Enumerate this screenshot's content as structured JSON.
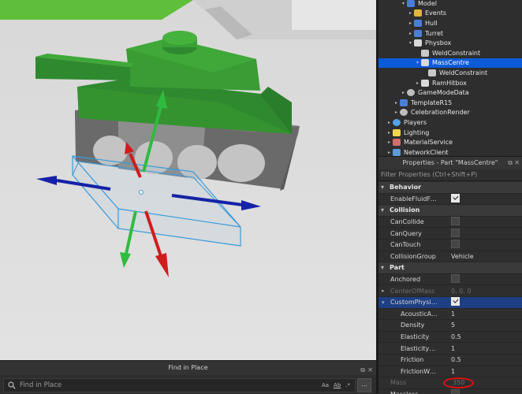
{
  "explorer": {
    "items": [
      {
        "label": "Model",
        "icon": "model-icon",
        "arrow": "▾",
        "indent": 0
      },
      {
        "label": "Events",
        "icon": "folder-icon",
        "arrow": "▸",
        "indent": 1
      },
      {
        "label": "Hull",
        "icon": "model-icon",
        "arrow": "▸",
        "indent": 1
      },
      {
        "label": "Turret",
        "icon": "model-icon",
        "arrow": "▸",
        "indent": 1
      },
      {
        "label": "Physbox",
        "icon": "part-icon",
        "arrow": "▾",
        "indent": 1
      },
      {
        "label": "WeldConstraint",
        "icon": "constraint-icon",
        "arrow": "",
        "indent": 2
      },
      {
        "label": "MassCentre",
        "icon": "part-icon",
        "arrow": "▾",
        "indent": 2,
        "selected": true
      },
      {
        "label": "WeldConstraint",
        "icon": "constraint-icon",
        "arrow": "",
        "indent": 3
      },
      {
        "label": "RamHitbox",
        "icon": "part-icon",
        "arrow": "▸",
        "indent": 2
      },
      {
        "label": "GameModeData",
        "icon": "gear-icon",
        "arrow": "▸",
        "indent": 0
      },
      {
        "label": "TemplateR15",
        "icon": "model-icon",
        "arrow": "▸",
        "indent": -1
      },
      {
        "label": "CelebrationRender",
        "icon": "gear-icon",
        "arrow": "▸",
        "indent": -1
      },
      {
        "label": "Players",
        "icon": "players-icon",
        "arrow": "▸",
        "indent": -2
      },
      {
        "label": "Lighting",
        "icon": "lighting-icon",
        "arrow": "▸",
        "indent": -2
      },
      {
        "label": "MaterialService",
        "icon": "material-icon",
        "arrow": "▸",
        "indent": -2
      },
      {
        "label": "NetworkClient",
        "icon": "network-icon",
        "arrow": "▸",
        "indent": -2
      }
    ]
  },
  "properties": {
    "title": "Properties - Part \"MassCentre\"",
    "filter_placeholder": "Filter Properties (Ctrl+Shift+P)",
    "rows": [
      {
        "kind": "cat",
        "name": "Behavior"
      },
      {
        "kind": "prop",
        "name": "EnableFluidForces",
        "type": "check",
        "checked": true
      },
      {
        "kind": "cat",
        "name": "Collision"
      },
      {
        "kind": "prop",
        "name": "CanCollide",
        "type": "check",
        "checked": false
      },
      {
        "kind": "prop",
        "name": "CanQuery",
        "type": "check",
        "checked": false
      },
      {
        "kind": "prop",
        "name": "CanTouch",
        "type": "check",
        "checked": false
      },
      {
        "kind": "prop",
        "name": "CollisionGroup",
        "type": "text",
        "value": "Vehicle"
      },
      {
        "kind": "cat",
        "name": "Part"
      },
      {
        "kind": "prop",
        "name": "Anchored",
        "type": "check",
        "checked": false
      },
      {
        "kind": "prop",
        "name": "CenterOfMass",
        "type": "text",
        "value": "0, 0, 0",
        "dim": true
      },
      {
        "kind": "prop",
        "name": "CustomPhysicalPro...",
        "type": "check",
        "checked": true,
        "selected": true
      },
      {
        "kind": "sub",
        "name": "AcousticAbsorpt...",
        "type": "text",
        "value": "1"
      },
      {
        "kind": "sub",
        "name": "Density",
        "type": "text",
        "value": "5"
      },
      {
        "kind": "sub",
        "name": "Elasticity",
        "type": "text",
        "value": "0.5"
      },
      {
        "kind": "sub",
        "name": "ElasticityWeight",
        "type": "text",
        "value": "1"
      },
      {
        "kind": "sub",
        "name": "Friction",
        "type": "text",
        "value": "0.5"
      },
      {
        "kind": "sub",
        "name": "FrictionWeight",
        "type": "text",
        "value": "1"
      },
      {
        "kind": "prop",
        "name": "Mass",
        "type": "text",
        "value": "350",
        "dim": true
      },
      {
        "kind": "prop",
        "name": "Massless",
        "type": "check",
        "checked": false
      }
    ]
  },
  "find": {
    "title": "Find in Place",
    "placeholder": "Find in Place",
    "opt_case": "Aa",
    "opt_word": "Ab",
    "opt_regex": ".*",
    "more": "..."
  },
  "colors": {
    "selection": "#0b5bd8",
    "tank_green": "#2f8a2f",
    "mass_highlight": "#e01010"
  }
}
